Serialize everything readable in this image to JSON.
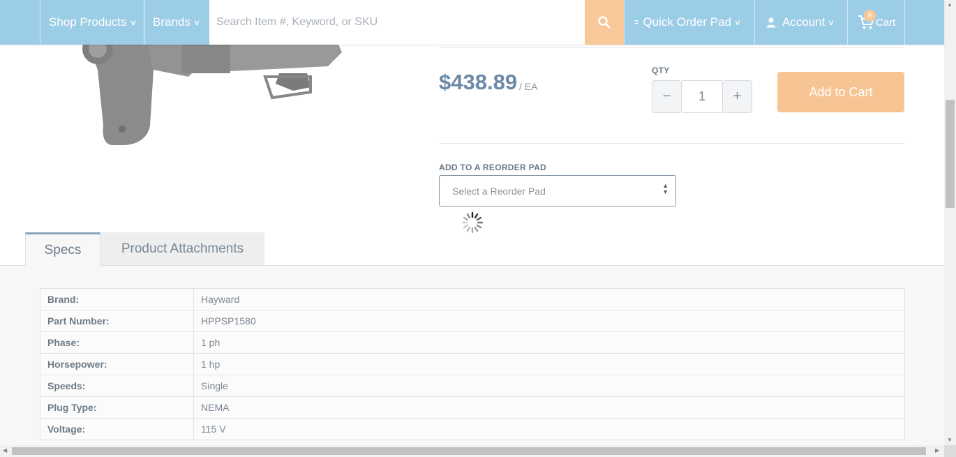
{
  "header": {
    "shop_products": "Shop Products",
    "brands": "Brands",
    "search_placeholder": "Search Item #, Keyword, or SKU",
    "quick_order_pad": "Quick Order Pad",
    "account": "Account",
    "cart": "Cart",
    "cart_count": "8",
    "colors": {
      "bar": "#9ccde6",
      "accent": "#f8c89a"
    }
  },
  "product": {
    "price": "$438.89",
    "unit": "/ EA",
    "qty_label": "QTY",
    "qty_value": "1",
    "add_to_cart": "Add to Cart",
    "reorder_label": "ADD TO A REORDER PAD",
    "reorder_placeholder": "Select a Reorder Pad"
  },
  "tabs": [
    {
      "label": "Specs",
      "active": true
    },
    {
      "label": "Product Attachments",
      "active": false
    }
  ],
  "specs": [
    {
      "key": "Brand:",
      "value": "Hayward"
    },
    {
      "key": "Part Number:",
      "value": "HPPSP1580"
    },
    {
      "key": "Phase:",
      "value": "1 ph"
    },
    {
      "key": "Horsepower:",
      "value": "1 hp"
    },
    {
      "key": "Speeds:",
      "value": "Single"
    },
    {
      "key": "Plug Type:",
      "value": "NEMA"
    },
    {
      "key": "Voltage:",
      "value": "115 V"
    }
  ]
}
